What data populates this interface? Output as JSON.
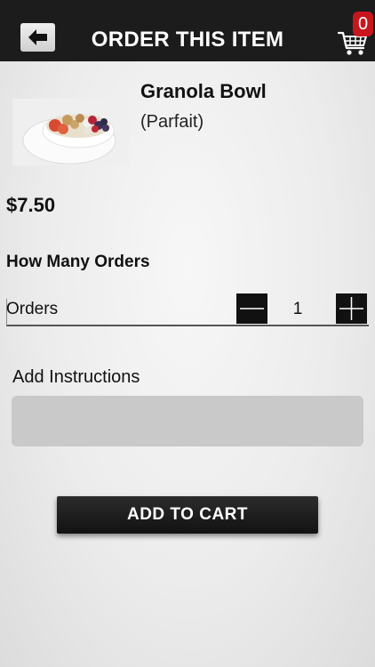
{
  "header": {
    "title": "ORDER THIS ITEM",
    "back_icon": "back-arrow-icon",
    "cart_icon": "shopping-cart-icon",
    "cart_count": "0"
  },
  "item": {
    "name": "Granola Bowl",
    "subtitle": "(Parfait)",
    "price": "$7.50"
  },
  "orders": {
    "section_title": "How Many Orders",
    "label": "Orders",
    "quantity": "1"
  },
  "instructions": {
    "label": "Add Instructions",
    "placeholder": "",
    "value": ""
  },
  "actions": {
    "add_to_cart_label": "ADD TO CART"
  },
  "colors": {
    "header_bg": "#1c1c1c",
    "badge": "#c8161d",
    "button_bg": "#1a1a1a",
    "input_bg": "#c9c9c9"
  }
}
